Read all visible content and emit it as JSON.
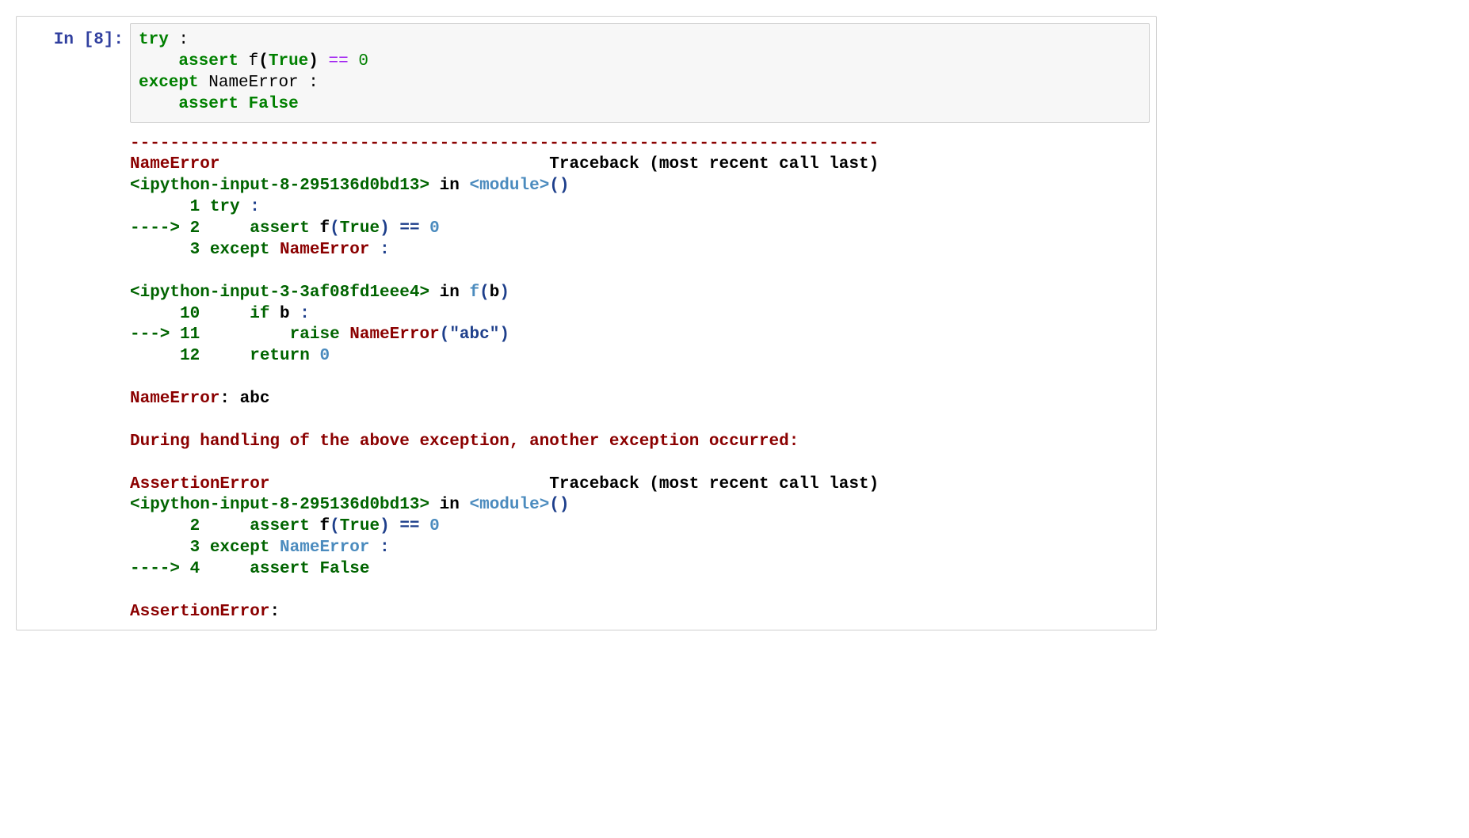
{
  "prompt": "In [8]:",
  "code": {
    "l1": {
      "try": "try",
      "colon": " :"
    },
    "l2": {
      "indent": "    ",
      "assert": "assert",
      "sp": " ",
      "fn": "f",
      "lp": "(",
      "arg": "True",
      "rp": ")",
      "sp2": " ",
      "op": "==",
      "sp3": " ",
      "zero": "0"
    },
    "l3": {
      "except": "except",
      "sp": " ",
      "err": "NameError",
      "colon": " :"
    },
    "l4": {
      "indent": "    ",
      "assert": "assert",
      "sp": " ",
      "false": "False"
    }
  },
  "out": {
    "dash": "---------------------------------------------------------------------------",
    "ne_header_left": "NameError",
    "ne_header_right": "Traceback (most recent call last)",
    "ne_header_pad": "                                 ",
    "src1_pre": "<ipython-input-8-295136d0bd13>",
    "in_word": " in ",
    "module": "<module>",
    "parens": "()",
    "l_try_num": "      1",
    "l_try_code_try": " try",
    "l_try_colon": " :",
    "arrow4": "----> ",
    "l2_num": "2",
    "l2_indent": "     ",
    "l2_assert": "assert",
    "l2_f": " f",
    "l2_lp": "(",
    "l2_true": "True",
    "l2_rp": ")",
    "l2_eq": " == ",
    "l2_zero": "0",
    "l3_num": "      3",
    "l3_except": " except",
    "l3_nameerror": " NameError",
    "l3_colon": " :",
    "src2_pre": "<ipython-input-3-3af08fd1eee4>",
    "f_sig_f": "f",
    "f_sig_lp": "(",
    "f_sig_b": "b",
    "f_sig_rp": ")",
    "l10_num": "     10",
    "l10_if": "     if",
    "l10_b": " b",
    "l10_colon": " :",
    "arrow3": "---> ",
    "l11_num": "11",
    "l11_indent": "         ",
    "l11_raise": "raise",
    "l11_nameerror": " NameError",
    "l11_lp": "(",
    "l11_str": "\"abc\"",
    "l11_rp": ")",
    "l12_num": "     12",
    "l12_return": "     return",
    "l12_zero": " 0",
    "ne_final": "NameError",
    "ne_final_msg": ": abc",
    "during": "During handling of the above exception, another exception occurred:",
    "ae_header_left": "AssertionError",
    "ae_header_pad": "                            ",
    "ae_header_right": "Traceback (most recent call last)",
    "src3_pre": "<ipython-input-8-295136d0bd13>",
    "a_l2_num": "      2",
    "a_l2_indent": "     ",
    "a_l2_assert": "assert",
    "a_l2_f": " f",
    "a_l2_lp": "(",
    "a_l2_true": "True",
    "a_l2_rp": ")",
    "a_l2_eq": " == ",
    "a_l2_zero": "0",
    "a_l3_num": "      3",
    "a_l3_except": " except",
    "a_l3_nameerror": " NameError",
    "a_l3_colon": " :",
    "a_arrow4": "----> ",
    "a_l4_num": "4",
    "a_l4_indent": "     ",
    "a_l4_assert": "assert",
    "a_l4_false": " False",
    "ae_final": "AssertionError",
    "ae_final_msg": ": "
  }
}
